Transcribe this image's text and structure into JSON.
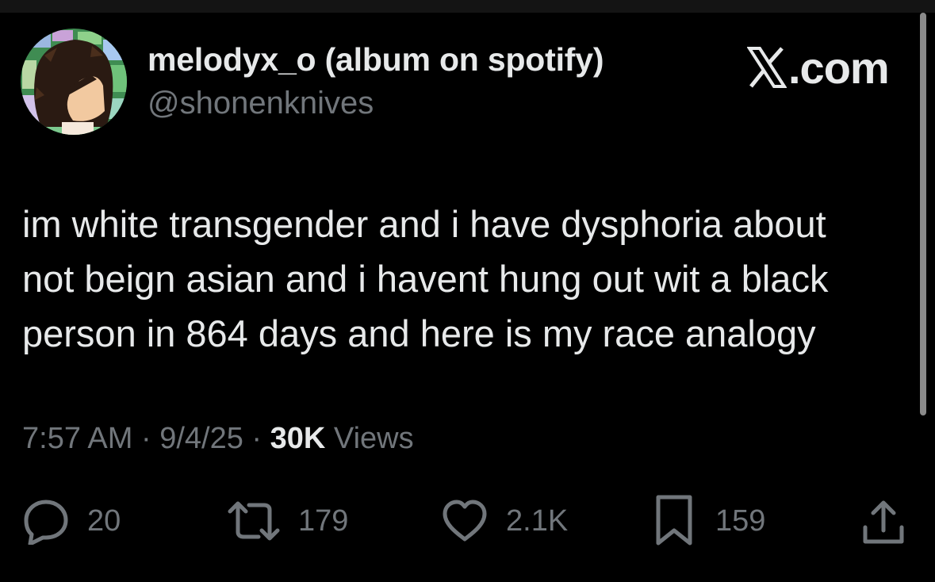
{
  "author": {
    "display_name": "melodyx_o (album on spotify)",
    "handle": "@shonenknives",
    "avatar_icon": "cartoon-avatar"
  },
  "brand": {
    "icon": "x-logo-icon",
    "label": ".com"
  },
  "tweet": {
    "lines": [
      "im white transgender and i have dysphoria about",
      "not beign asian and i havent hung out wit a black",
      "person in 864 days and here is my race analogy"
    ]
  },
  "meta": {
    "time": "7:57 AM",
    "separator": " · ",
    "date": "9/4/25",
    "views_count": "30K",
    "views_label": " Views"
  },
  "actions": {
    "reply_count": "20",
    "retweet_count": "179",
    "like_count": "2.1K",
    "bookmark_count": "159"
  },
  "colors": {
    "background": "#000000",
    "primary_text": "#e7e9ea",
    "secondary_text": "#71767b"
  }
}
